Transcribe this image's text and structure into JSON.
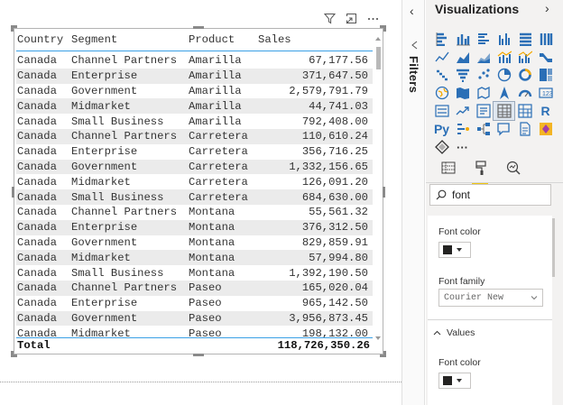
{
  "visual_header": {
    "icons": [
      "filter-icon",
      "focus-mode-icon",
      "more-options-icon"
    ]
  },
  "table": {
    "headers": [
      "Country",
      "Segment",
      "Product",
      "Sales"
    ],
    "rows": [
      [
        "Canada",
        "Channel Partners",
        "Amarilla",
        "67,177.56"
      ],
      [
        "Canada",
        "Enterprise",
        "Amarilla",
        "371,647.50"
      ],
      [
        "Canada",
        "Government",
        "Amarilla",
        "2,579,791.79"
      ],
      [
        "Canada",
        "Midmarket",
        "Amarilla",
        "44,741.03"
      ],
      [
        "Canada",
        "Small Business",
        "Amarilla",
        "792,408.00"
      ],
      [
        "Canada",
        "Channel Partners",
        "Carretera",
        "110,610.24"
      ],
      [
        "Canada",
        "Enterprise",
        "Carretera",
        "356,716.25"
      ],
      [
        "Canada",
        "Government",
        "Carretera",
        "1,332,156.65"
      ],
      [
        "Canada",
        "Midmarket",
        "Carretera",
        "126,091.20"
      ],
      [
        "Canada",
        "Small Business",
        "Carretera",
        "684,630.00"
      ],
      [
        "Canada",
        "Channel Partners",
        "Montana",
        "55,561.32"
      ],
      [
        "Canada",
        "Enterprise",
        "Montana",
        "376,312.50"
      ],
      [
        "Canada",
        "Government",
        "Montana",
        "829,859.91"
      ],
      [
        "Canada",
        "Midmarket",
        "Montana",
        "57,994.80"
      ],
      [
        "Canada",
        "Small Business",
        "Montana",
        "1,392,190.50"
      ],
      [
        "Canada",
        "Channel Partners",
        "Paseo",
        "165,020.04"
      ],
      [
        "Canada",
        "Enterprise",
        "Paseo",
        "965,142.50"
      ],
      [
        "Canada",
        "Government",
        "Paseo",
        "3,956,873.45"
      ],
      [
        "Canada",
        "Midmarket",
        "Paseo",
        "198,132.00"
      ]
    ],
    "total_label": "Total",
    "total_value": "118,726,350.26",
    "scroll_position": 0.0
  },
  "filters_pane": {
    "label": "Filters",
    "collapse_icon": "chevron-left-icon"
  },
  "visualizations_pane": {
    "title": "Visualizations",
    "expand_icon": "chevron-right-icon",
    "visual_icons": [
      "stacked-bar-icon",
      "stacked-column-icon",
      "clustered-bar-icon",
      "clustered-column-icon",
      "100-bar-icon",
      "100-column-icon",
      "line-chart-icon",
      "area-chart-icon",
      "stacked-area-icon",
      "line-column-icon",
      "line-clustered-icon",
      "ribbon-chart-icon",
      "waterfall-icon",
      "funnel-icon",
      "scatter-icon",
      "pie-chart-icon",
      "donut-chart-icon",
      "treemap-icon",
      "map-icon",
      "filled-map-icon",
      "shape-map-icon",
      "arcgis-icon",
      "gauge-icon",
      "card-icon",
      "multirow-card-icon",
      "kpi-icon",
      "slicer-icon",
      "table-icon",
      "matrix-icon",
      "r-visual-icon",
      "python-visual-icon",
      "key-influencers-icon",
      "decomposition-tree-icon",
      "qa-icon",
      "paginated-report-icon",
      "power-apps-icon",
      "power-automate-icon",
      "more-visuals-icon"
    ],
    "r_label": "R",
    "py_label": "Py",
    "more_label": "···",
    "pane_tabs": [
      "fields-tab-icon",
      "format-tab-icon",
      "analytics-tab-icon"
    ],
    "search": {
      "value": "font",
      "icon": "search-icon"
    },
    "format": {
      "font_color_label": "Font color",
      "font_color": "#252423",
      "font_family_label": "Font family",
      "font_family_value": "Courier New",
      "values_section_label": "Values",
      "values_font_color_label": "Font color",
      "values_font_color": "#252423"
    }
  },
  "colors": {
    "accent_blue": "#3aa0e6",
    "alt_row": "#ebebeb",
    "active_tab_underline": "#f2c811",
    "pane_bg": "#f3f2f1"
  }
}
